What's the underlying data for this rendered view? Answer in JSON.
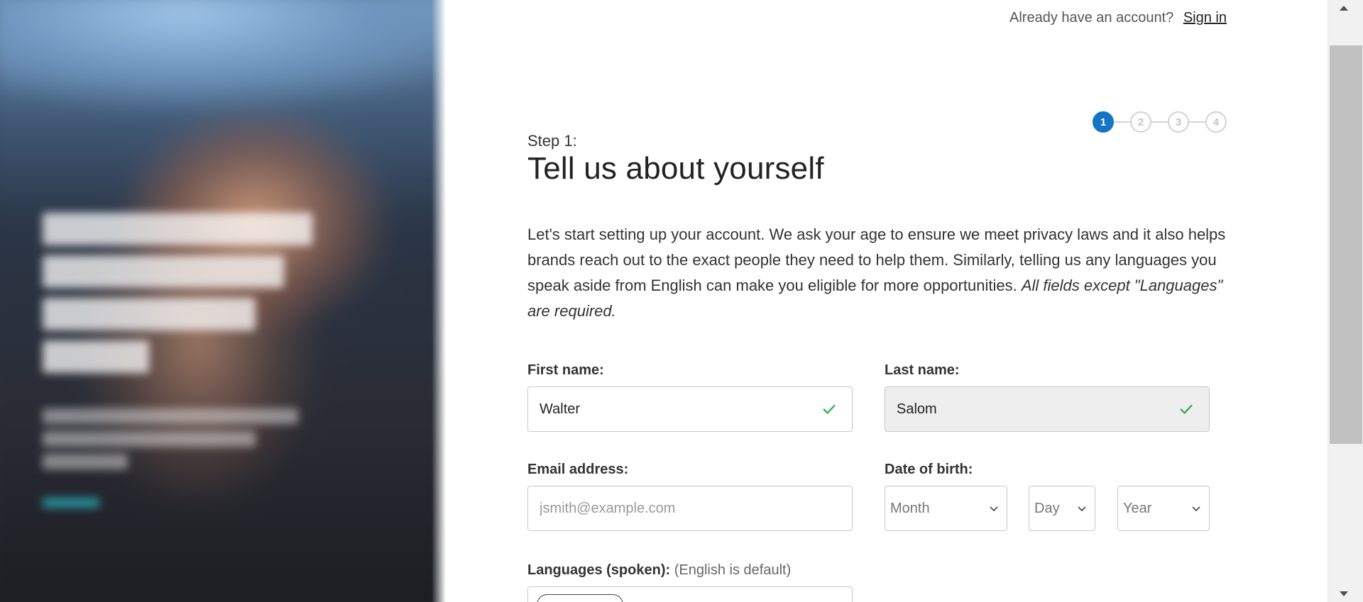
{
  "header": {
    "already_text": "Already have an account?",
    "sign_in_label": "Sign in"
  },
  "stepper": {
    "steps": [
      "1",
      "2",
      "3",
      "4"
    ],
    "current": 1
  },
  "main": {
    "step_label": "Step 1:",
    "title": "Tell us about yourself",
    "intro": "Let's start setting up your account. We ask your age to ensure we meet privacy laws and it also helps brands reach out to the exact people they need to help them. Similarly, telling us any languages you speak aside from English can make you eligible for more opportunities.",
    "intro_note": "All fields except \"Languages\" are required."
  },
  "form": {
    "first_name": {
      "label": "First name:",
      "value": "Walter"
    },
    "last_name": {
      "label": "Last name:",
      "value": "Salom"
    },
    "email": {
      "label": "Email address:",
      "value": "",
      "placeholder": "jsmith@example.com"
    },
    "dob": {
      "label": "Date of birth:",
      "month": "Month",
      "day": "Day",
      "year": "Year"
    },
    "languages": {
      "label": "Languages (spoken):",
      "hint": "(English is default)"
    }
  },
  "colors": {
    "accent": "#1574c4",
    "check": "#2aaa4f",
    "inactive_step": "#d3d3d3"
  },
  "icons": {
    "field_valid": "check-icon",
    "select_arrow": "chevron-down-icon"
  }
}
